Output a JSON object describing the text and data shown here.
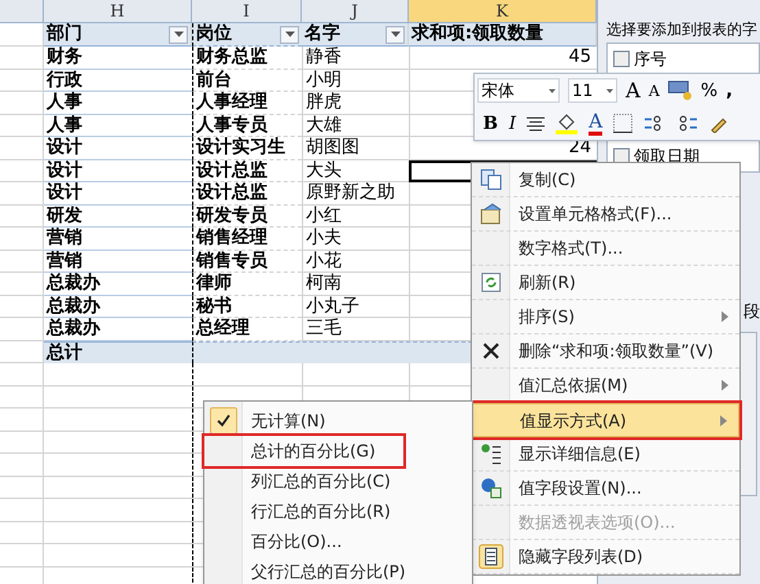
{
  "column_headers": [
    {
      "label": "H",
      "selected": false
    },
    {
      "label": "I",
      "selected": false
    },
    {
      "label": "J",
      "selected": false
    },
    {
      "label": "K",
      "selected": true
    }
  ],
  "pivot_header": [
    {
      "label": "部门",
      "filter": true
    },
    {
      "label": "岗位",
      "filter": true
    },
    {
      "label": "名字",
      "filter": true
    },
    {
      "label": "求和项:领取数量",
      "filter": false
    }
  ],
  "rows": [
    {
      "department": "财务",
      "position": "财务总监",
      "name": "静香",
      "quantity": "45",
      "active": false
    },
    {
      "department": "行政",
      "position": "前台",
      "name": "小明",
      "active": false
    },
    {
      "department": "人事",
      "position": "人事经理",
      "name": "胖虎",
      "active": false
    },
    {
      "department": "人事",
      "position": "人事专员",
      "name": "大雄",
      "active": false
    },
    {
      "department": "设计",
      "position": "设计实习生",
      "name": "胡图图",
      "quantity": "24",
      "active": false
    },
    {
      "department": "设计",
      "position": "设计总监",
      "name": "大头",
      "active": true
    },
    {
      "department": "设计",
      "position": "设计总监",
      "name": "原野新之助",
      "active": false
    },
    {
      "department": "研发",
      "position": "研发专员",
      "name": "小红",
      "active": false
    },
    {
      "department": "营销",
      "position": "销售经理",
      "name": "小夫",
      "active": false
    },
    {
      "department": "营销",
      "position": "销售专员",
      "name": "小花",
      "active": false
    },
    {
      "department": "总裁办",
      "position": "律师",
      "name": "柯南",
      "active": false
    },
    {
      "department": "总裁办",
      "position": "秘书",
      "name": "小丸子",
      "active": false
    },
    {
      "department": "总裁办",
      "position": "总经理",
      "name": "三毛",
      "active": false
    }
  ],
  "total_row": {
    "label": "总计"
  },
  "field_panel": {
    "title": "选择要添加到报表的字",
    "fields": [
      {
        "label": "序号",
        "checked": false
      },
      {
        "label": "领取日期",
        "checked": false
      }
    ],
    "section_text": "段"
  },
  "mini_toolbar": {
    "font": "宋体",
    "size": "11",
    "grow_font": "A",
    "shrink_font": "A",
    "percent": "%",
    "comma": ",",
    "bold": "B",
    "italic": "I",
    "font_color": "A"
  },
  "context_menu": [
    {
      "label": "复制(C)",
      "kind": "copy",
      "submenu": false,
      "selected": false,
      "disabled": false,
      "outlined": false
    },
    {
      "label": "设置单元格格式(F)...",
      "kind": "format",
      "submenu": false,
      "selected": false,
      "disabled": false,
      "outlined": false
    },
    {
      "label": "数字格式(T)...",
      "kind": "plain",
      "submenu": false,
      "selected": false,
      "disabled": false,
      "outlined": false
    },
    {
      "label": "刷新(R)",
      "kind": "refresh",
      "submenu": false,
      "selected": false,
      "disabled": false,
      "outlined": false
    },
    {
      "label": "排序(S)",
      "kind": "plain",
      "submenu": true,
      "selected": false,
      "disabled": false,
      "outlined": false
    },
    {
      "label": "删除“求和项:领取数量”(V)",
      "kind": "delete",
      "submenu": false,
      "selected": false,
      "disabled": false,
      "outlined": false
    },
    {
      "label": "值汇总依据(M)",
      "kind": "plain",
      "submenu": true,
      "selected": false,
      "disabled": false,
      "outlined": false
    },
    {
      "label": "值显示方式(A)",
      "kind": "plain",
      "submenu": true,
      "selected": true,
      "disabled": false,
      "outlined": true
    },
    {
      "label": "显示详细信息(E)",
      "kind": "details",
      "submenu": false,
      "selected": false,
      "disabled": false,
      "outlined": false
    },
    {
      "label": "值字段设置(N)...",
      "kind": "settings",
      "submenu": false,
      "selected": false,
      "disabled": false,
      "outlined": false
    },
    {
      "label": "数据透视表选项(O)...",
      "kind": "plain",
      "submenu": false,
      "selected": false,
      "disabled": true,
      "outlined": false
    },
    {
      "label": "隐藏字段列表(D)",
      "kind": "fieldlist",
      "submenu": false,
      "selected": false,
      "disabled": false,
      "outlined": false
    }
  ],
  "submenu": [
    {
      "label": "无计算(N)",
      "checked": true,
      "outlined": false
    },
    {
      "label": "总计的百分比(G)",
      "checked": false,
      "outlined": true
    },
    {
      "label": "列汇总的百分比(C)",
      "checked": false,
      "outlined": false
    },
    {
      "label": "行汇总的百分比(R)",
      "checked": false,
      "outlined": false
    },
    {
      "label": "百分比(O)...",
      "checked": false,
      "outlined": false
    },
    {
      "label": "父行汇总的百分比(P)",
      "checked": false,
      "outlined": false
    }
  ]
}
